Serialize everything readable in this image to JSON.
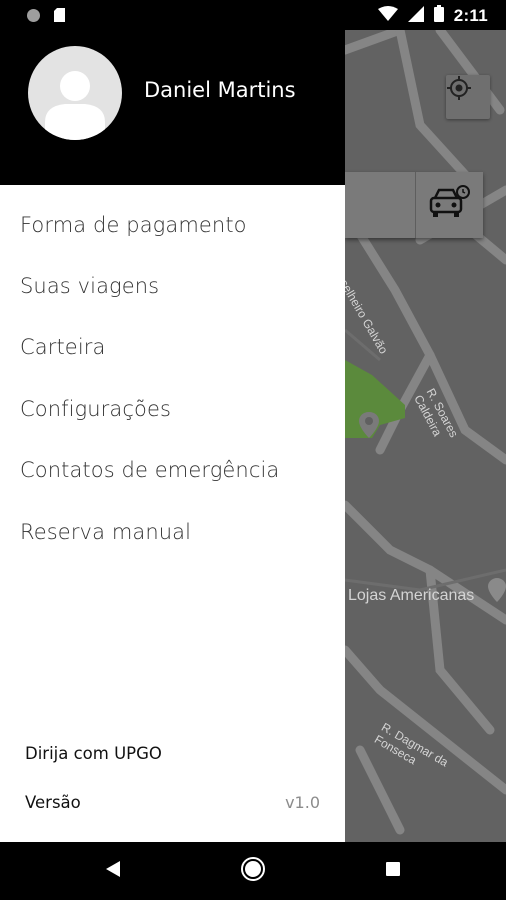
{
  "status_bar": {
    "time": "2:11",
    "icons": [
      "circle-notification-icon",
      "sd-card-icon",
      "wifi-icon",
      "cell-signal-icon",
      "battery-icon"
    ]
  },
  "map": {
    "street_labels": [
      "Conselheiro Galvão",
      "R. Soares Caldeira",
      "R. Dagmar da Fonseca",
      "Lojas Americanas"
    ],
    "icons": [
      "locate-me-icon",
      "car-schedule-icon",
      "poi-pin-icon"
    ]
  },
  "drawer": {
    "user_name": "Daniel Martins",
    "menu": [
      {
        "label": "Forma de pagamento"
      },
      {
        "label": "Suas viagens"
      },
      {
        "label": "Carteira"
      },
      {
        "label": "Configurações"
      },
      {
        "label": "Contatos de emergência"
      },
      {
        "label": "Reserva manual"
      }
    ],
    "footer": {
      "drive_link": "Dirija com UPGO",
      "version_label": "Versão",
      "version_value": "v1.0"
    }
  },
  "nav_bar": {
    "icons": [
      "back-icon",
      "home-icon",
      "recents-icon"
    ]
  },
  "colors": {
    "drawer_header": "#000000",
    "map_background": "#626262",
    "park_green": "#5b8a3c"
  }
}
